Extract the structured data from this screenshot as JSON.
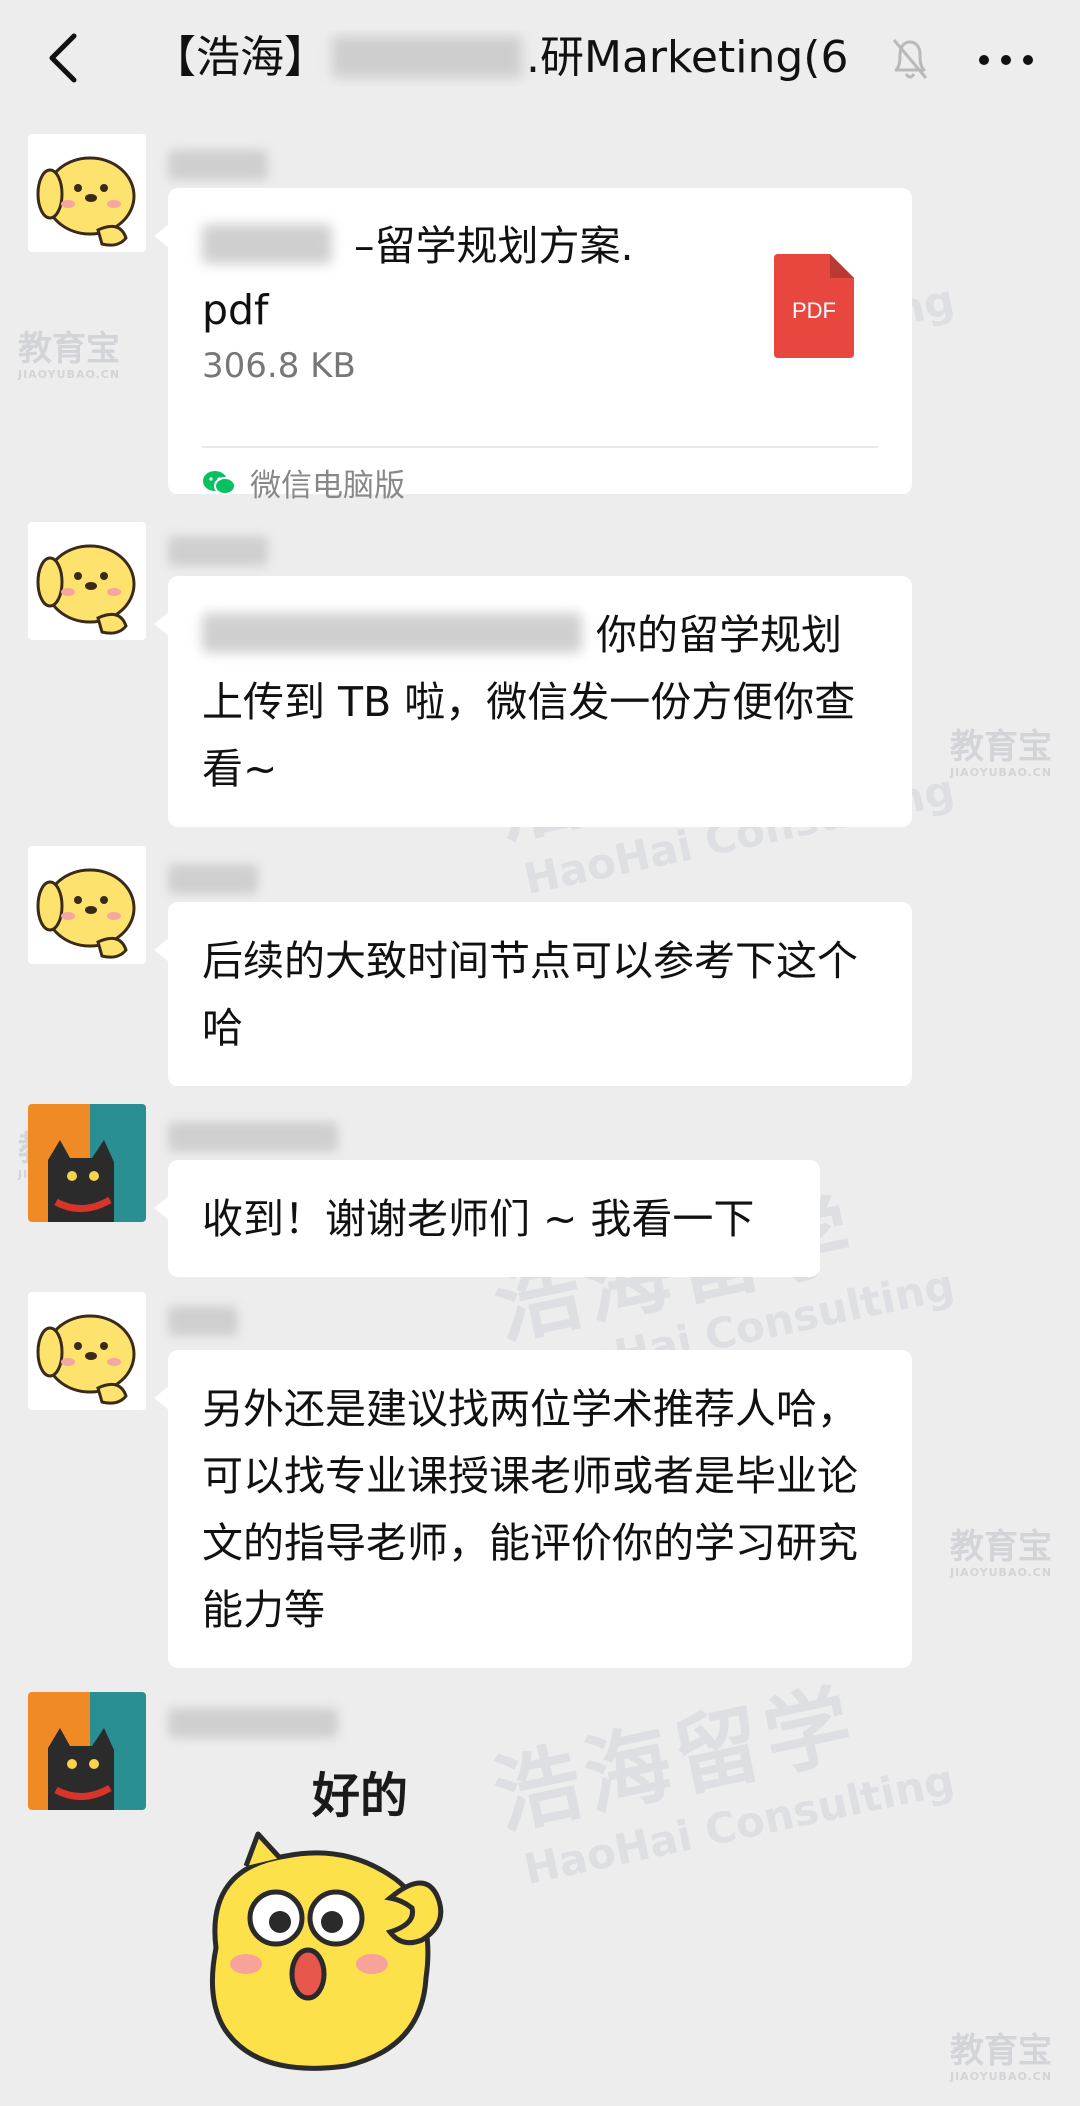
{
  "header": {
    "title_prefix": "【浩海】",
    "title_suffix": ".研Marketing(6　)"
  },
  "messages": [
    {
      "type": "file",
      "file_name_suffix": "–留学规划方案.",
      "file_name_ext": "pdf",
      "file_size": "306.8 KB",
      "source": "微信电脑版",
      "file_icon_label": "PDF"
    },
    {
      "type": "text",
      "text": "你的留学规划上传到 TB 啦，微信发一份方便你查看~"
    },
    {
      "type": "text",
      "text": "后续的大致时间节点可以参考下这个哈"
    },
    {
      "type": "text",
      "text": "收到！谢谢老师们 ~ 我看一下"
    },
    {
      "type": "text",
      "text": "另外还是建议找两位学术推荐人哈，可以找专业课授课老师或者是毕业论文的指导老师，能评价你的学习研究能力等"
    },
    {
      "type": "sticker",
      "caption": "好的"
    }
  ],
  "watermarks": {
    "cn": "浩海留学",
    "en": "HaoHai Consulting",
    "site_cn": "教育宝",
    "site_en": "JIAOYUBAO.CN"
  },
  "colors": {
    "background": "#ededed",
    "bubble": "#ffffff",
    "pdf_red": "#e8473f",
    "wechat_green": "#07c160"
  }
}
